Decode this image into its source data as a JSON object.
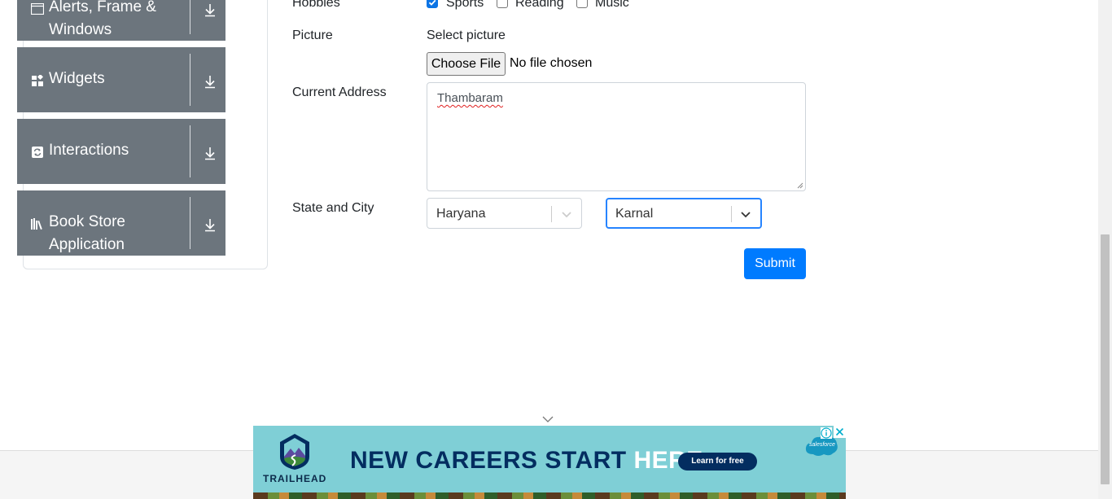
{
  "sidebar": {
    "groups": [
      {
        "label_line1": "Alerts, Frame &",
        "label_line2": "Windows",
        "icon": "window-icon"
      },
      {
        "label": "Widgets",
        "icon": "widgets-icon"
      },
      {
        "label": "Interactions",
        "icon": "interactions-icon"
      },
      {
        "label_line1": "Book Store",
        "label_line2": "Application",
        "icon": "book-icon"
      }
    ]
  },
  "form": {
    "hobbies": {
      "label": "Hobbies",
      "options": [
        {
          "label": "Sports",
          "checked": true
        },
        {
          "label": "Reading",
          "checked": false
        },
        {
          "label": "Music",
          "checked": false
        }
      ]
    },
    "picture": {
      "label": "Picture",
      "prompt": "Select picture",
      "button": "Choose File",
      "status": "No file chosen"
    },
    "address": {
      "label": "Current Address",
      "value": "Thambaram"
    },
    "state_city": {
      "label": "State and City",
      "state": "Haryana",
      "city": "Karnal"
    },
    "submit": "Submit"
  },
  "ad": {
    "brand": "TRAILHEAD",
    "headline_part1": "NEW CAREERS START ",
    "headline_part2": "HERE.",
    "cta": "Learn for free",
    "partner": "salesforce",
    "colors": {
      "background": "#7fcfd6",
      "headline": "#032d60",
      "cta_bg": "#032d60"
    }
  },
  "colors": {
    "sidebar_group": "#6c757d",
    "primary": "#007bff",
    "focus_border": "#2684ff",
    "checkbox_checked": "#0b74e5"
  }
}
